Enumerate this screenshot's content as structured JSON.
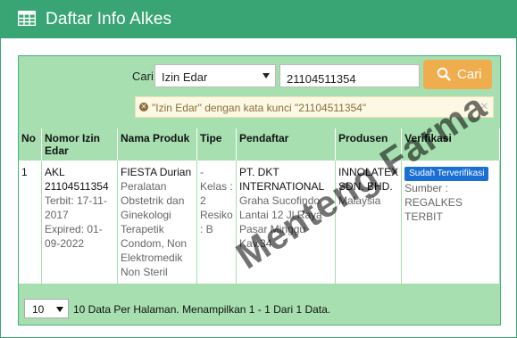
{
  "header": {
    "title": "Daftar Info Alkes",
    "icon": "table-icon"
  },
  "search": {
    "cari_label": "Cari",
    "field_selected": "Izin Edar",
    "query_value": "21104511354",
    "button_label": "Cari",
    "button_icon": "search-icon",
    "alert_text": "\"Izin Edar\" dengan kata kunci \"21104511354\"",
    "alert_close": "×"
  },
  "table": {
    "columns": [
      "No",
      "Nomor Izin Edar",
      "Nama Produk",
      "Tipe",
      "Pendaftar",
      "Produsen",
      "Verifikasi"
    ],
    "rows": [
      {
        "no": "1",
        "nomor": "AKL 21104511354",
        "terbit": "Terbit: 17-11-2017",
        "expired": "Expired: 01-09-2022",
        "produk_nama": "FIESTA Durian",
        "produk_desc": "Peralatan Obstetrik dan Ginekologi Terapetik Condom, Non Elektromedik Non Steril",
        "tipe": "- Kelas : 2 Resiko : B",
        "pendaftar_nama": "PT. DKT INTERNATIONAL",
        "pendaftar_alamat": "Graha Sucofindo Lantai 12 Jl.Raya Pasar Minggu Kav.34",
        "produsen_nama": "INNOLATEX SDN. BHD.",
        "produsen_negara": "Malaysia",
        "verifikasi_badge": "Sudah Terverifikasi",
        "sumber": "Sumber : REGALKES TERBIT"
      }
    ]
  },
  "footer": {
    "per_page": "10",
    "info": "10 Data Per Halaman. Menampilkan 1 - 1 Dari 1 Data."
  },
  "watermark": "Menteng Farma",
  "colors": {
    "primary": "#3aa574",
    "panel": "#a7dfb0",
    "button": "#f0ad4e",
    "badge": "#1a6fd4"
  }
}
